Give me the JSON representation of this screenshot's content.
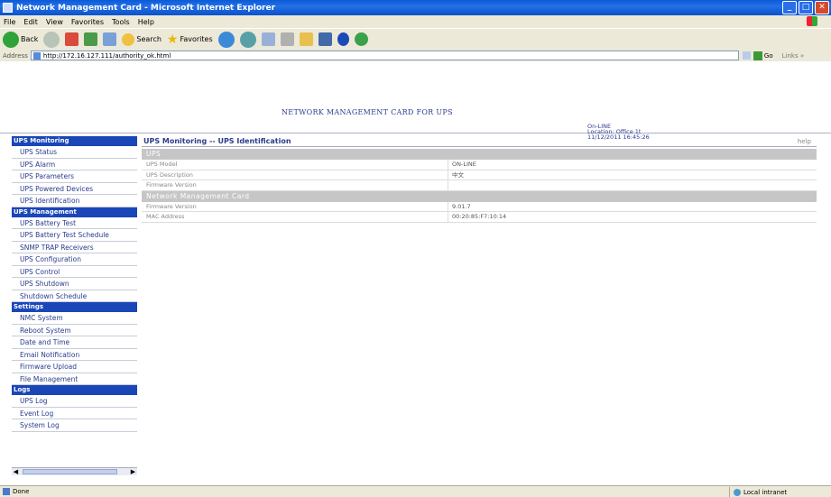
{
  "window": {
    "title": "Network Management Card - Microsoft Internet Explorer"
  },
  "menu": [
    "File",
    "Edit",
    "View",
    "Favorites",
    "Tools",
    "Help"
  ],
  "toolbar": {
    "back_label": "Back",
    "search_label": "Search",
    "favorites_label": "Favorites"
  },
  "address": {
    "label": "Address",
    "url": "http://172.16.127.111/authority_ok.html",
    "go_label": "Go",
    "links_label": "Links »"
  },
  "header": {
    "title": "NETWORK MANAGEMENT CARD FOR UPS",
    "status_line": "On-LINE",
    "location_line": "Location: Office 1t",
    "datetime_line": "11/12/2011 16:45:26"
  },
  "sidebar": {
    "sections": [
      {
        "title": "UPS Monitoring",
        "items": [
          "UPS Status",
          "UPS Alarm",
          "UPS Parameters",
          "UPS Powered Devices",
          "UPS Identification"
        ]
      },
      {
        "title": "UPS Management",
        "items": [
          "UPS Battery Test",
          "UPS Battery Test Schedule",
          "SNMP TRAP Receivers",
          "UPS Configuration",
          "UPS Control",
          "UPS Shutdown",
          "Shutdown Schedule"
        ]
      },
      {
        "title": "Settings",
        "items": [
          "NMC System",
          "Reboot System",
          "Date and Time",
          "Email Notification",
          "Firmware Upload",
          "File Management"
        ]
      },
      {
        "title": "Logs",
        "items": [
          "UPS Log",
          "Event Log",
          "System Log"
        ]
      }
    ]
  },
  "content": {
    "breadcrumb": "UPS Monitoring -- UPS Identification",
    "help": "help",
    "sections": [
      {
        "title": "UPS",
        "rows": [
          {
            "key": "UPS Model",
            "value": "ON-LINE"
          },
          {
            "key": "UPS Description",
            "value": "中文"
          },
          {
            "key": "Firmware Version",
            "value": ""
          }
        ]
      },
      {
        "title": "Network Management Card",
        "rows": [
          {
            "key": "Firmware Version",
            "value": "9.01.7"
          },
          {
            "key": "MAC Address",
            "value": "00:20:85:F7:10:14"
          }
        ]
      }
    ]
  },
  "statusbar": {
    "left": "Done",
    "zone": "Local intranet"
  },
  "colors": {
    "titlebar": "#0a5bd8",
    "sidebar_header": "#1a46b8",
    "link_text": "#2a3c8c",
    "section_header": "#c6c6c6"
  }
}
